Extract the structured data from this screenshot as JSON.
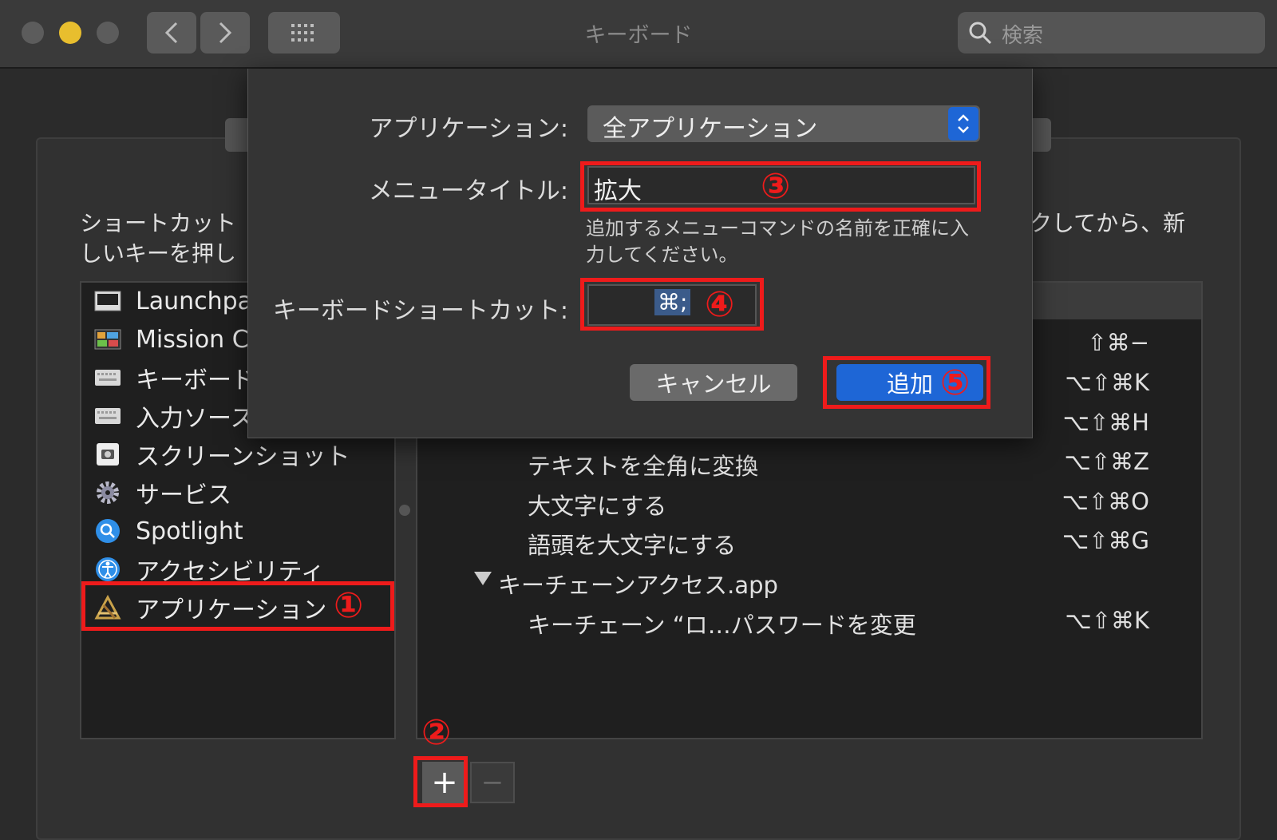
{
  "window": {
    "title": "キーボード",
    "search_placeholder": "検索"
  },
  "background": {
    "desc_left_1": "ショートカット",
    "desc_left_2": "しいキーを押し",
    "desc_right": "クしてから、新"
  },
  "sidebar": {
    "items": [
      {
        "label": "Launchpa",
        "icon": "launchpad-icon"
      },
      {
        "label": "Mission C",
        "icon": "mission-control-icon"
      },
      {
        "label": "キーボード",
        "icon": "keyboard-icon"
      },
      {
        "label": "入力ソース",
        "icon": "keyboard-icon"
      },
      {
        "label": "スクリーンショット",
        "icon": "screenshot-icon"
      },
      {
        "label": "サービス",
        "icon": "gear-icon"
      },
      {
        "label": "Spotlight",
        "icon": "spotlight-icon"
      },
      {
        "label": "アクセシビリティ",
        "icon": "accessibility-icon"
      },
      {
        "label": "アプリケーション",
        "icon": "app-store-icon"
      }
    ]
  },
  "shortcuts": {
    "rows": [
      {
        "name": "",
        "shortcut": "⇧⌘−"
      },
      {
        "name": "",
        "shortcut": "⌥⇧⌘K"
      },
      {
        "name": "",
        "shortcut": "⌥⇧⌘H"
      },
      {
        "name": "テキストを全角に変換",
        "shortcut": "⌥⇧⌘Z"
      },
      {
        "name": "大文字にする",
        "shortcut": "⌥⇧⌘O"
      },
      {
        "name": "語頭を大文字にする",
        "shortcut": "⌥⇧⌘G"
      },
      {
        "name": "キーチェーンアクセス.app",
        "shortcut": ""
      },
      {
        "name": "キーチェーン “ロ…パスワードを変更",
        "shortcut": "⌥⇧⌘K"
      }
    ]
  },
  "dialog": {
    "app_label": "アプリケーション:",
    "app_value": "全アプリケーション",
    "menu_title_label": "メニュータイトル:",
    "menu_title_value": "拡大",
    "hint_line1": "追加するメニューコマンドの名前を正確に入",
    "hint_line2": "力してください。",
    "shortcut_label": "キーボードショートカット:",
    "shortcut_value": "⌘;",
    "cancel_label": "キャンセル",
    "add_label": "追加"
  },
  "annotations": {
    "n1": "①",
    "n2": "②",
    "n3": "③",
    "n4": "④",
    "n5": "⑤"
  },
  "controls": {
    "plus": "+",
    "minus": "−"
  },
  "colors": {
    "accent": "#1e66d6",
    "annotation": "#ee1b1b"
  }
}
